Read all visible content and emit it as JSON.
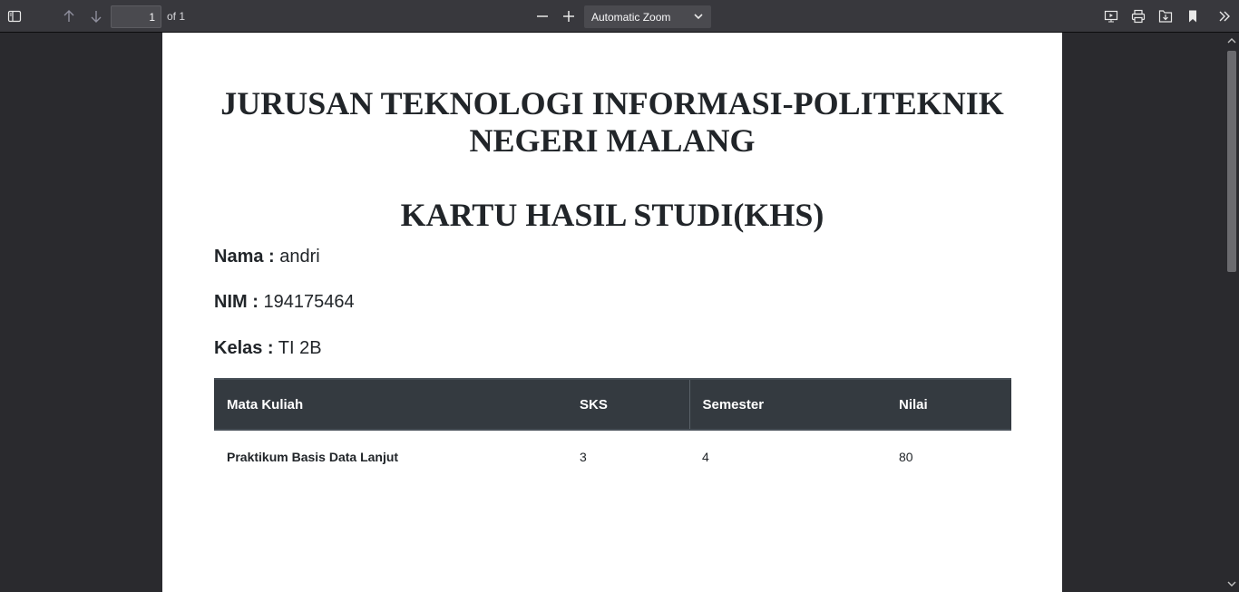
{
  "toolbar": {
    "page_number": "1",
    "page_count": "of 1",
    "zoom": "Automatic Zoom",
    "icons": {
      "sidebar": "sidebar-toggle-icon",
      "prev": "arrow-up-icon",
      "next": "arrow-down-icon",
      "zoom_out": "minus-icon",
      "zoom_in": "plus-icon",
      "presentation": "presentation-mode-icon",
      "print": "print-icon",
      "download": "download-icon",
      "bookmark": "bookmark-icon",
      "tools": "double-chevron-right-icon"
    }
  },
  "document": {
    "title_line1": "JURUSAN TEKNOLOGI INFORMASI-POLITEKNIK",
    "title_line2": "NEGERI MALANG",
    "subtitle": "KARTU HASIL STUDI(KHS)",
    "fields": [
      {
        "label": "Nama :",
        "value": "andri"
      },
      {
        "label": "NIM :",
        "value": "194175464"
      },
      {
        "label": "Kelas :",
        "value": "TI 2B"
      }
    ],
    "table": {
      "headers": [
        "Mata Kuliah",
        "SKS",
        "Semester",
        "Nilai"
      ],
      "rows": [
        [
          "Praktikum Basis Data Lanjut",
          "3",
          "4",
          "80"
        ]
      ]
    }
  },
  "colors": {
    "toolbar_bg": "#38383d",
    "viewer_bg": "#2a2a2e",
    "table_header_bg": "#343a40"
  }
}
